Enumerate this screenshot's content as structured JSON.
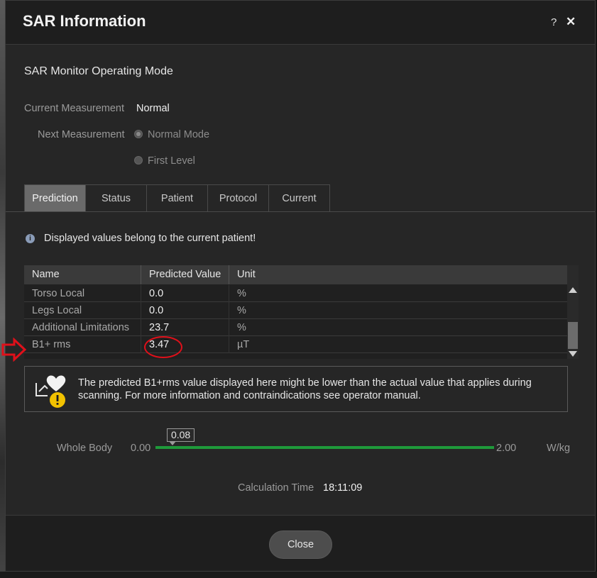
{
  "dialog": {
    "title": "SAR Information",
    "help_label": "?",
    "close_glyph": "✕"
  },
  "mode": {
    "section_title": "SAR Monitor Operating Mode",
    "current_label": "Current Measurement",
    "current_value": "Normal",
    "next_label": "Next Measurement",
    "options": [
      {
        "label": "Normal Mode",
        "selected": true
      },
      {
        "label": "First Level",
        "selected": false
      }
    ]
  },
  "tabs": [
    {
      "label": "Prediction",
      "active": true
    },
    {
      "label": "Status",
      "active": false
    },
    {
      "label": "Patient",
      "active": false
    },
    {
      "label": "Protocol",
      "active": false
    },
    {
      "label": "Current",
      "active": false
    }
  ],
  "info": {
    "icon": "info-icon",
    "text": "Displayed values belong to the current patient!"
  },
  "table": {
    "headers": [
      "Name",
      "Predicted Value",
      "Unit"
    ],
    "rows": [
      {
        "name": "Torso Local",
        "value": "0.0",
        "unit": "%"
      },
      {
        "name": "Legs Local",
        "value": "0.0",
        "unit": "%"
      },
      {
        "name": "Additional Limitations",
        "value": "23.7",
        "unit": "%"
      },
      {
        "name": "B1+ rms",
        "value": "3.47",
        "unit": "µT"
      }
    ]
  },
  "warning": {
    "icon": "heart-warning-icon",
    "text": "The predicted B1+rms value displayed here might be lower than the actual value that applies during scanning. For more information and contraindications see operator manual."
  },
  "whole_body": {
    "label": "Whole Body",
    "min": "0.00",
    "max": "2.00",
    "unit": "W/kg",
    "current": "0.08",
    "track_color": "#1e9a3a"
  },
  "calculation": {
    "label": "Calculation Time",
    "value": "18:11:09"
  },
  "footer": {
    "close_label": "Close"
  },
  "annotation": {
    "color": "#e0101a"
  }
}
